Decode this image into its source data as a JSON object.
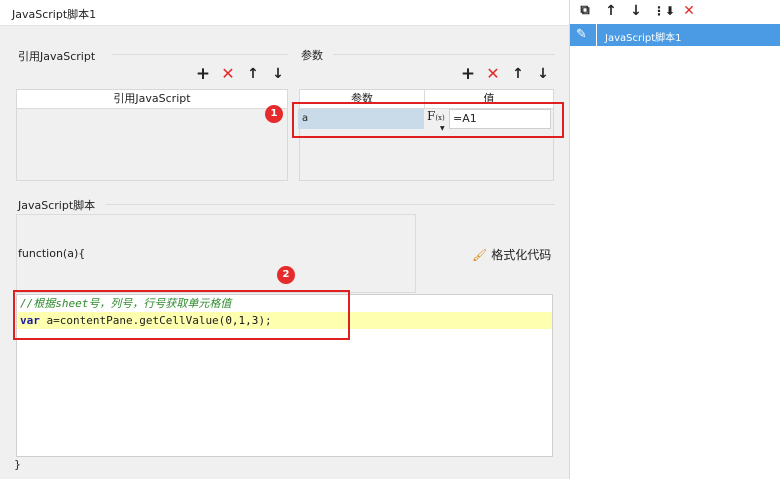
{
  "window": {
    "title": "JavaScript脚本1"
  },
  "libs": {
    "section_label": "引用JavaScript",
    "column_header": "引用JavaScript"
  },
  "params": {
    "section_label": "参数",
    "col_param": "参数",
    "col_value": "值",
    "row": {
      "name": "a",
      "formula_icon_text": "F",
      "formula_icon_sub": "(x)",
      "value": "=A1"
    }
  },
  "script": {
    "section_label": "JavaScript脚本",
    "function_signature": "function(a){",
    "format_label": "格式化代码",
    "code": {
      "comment": "//根据sheet号，列号，行号获取单元格值",
      "keyword": "var",
      "statement_start": " a=contentPane.getCellValue(",
      "args": "0,1,3",
      "statement_end": ");"
    },
    "closing": "}"
  },
  "annotations": {
    "badge1": "1",
    "badge2": "2"
  },
  "sidebar": {
    "items": [
      {
        "label": "JavaScript脚本1",
        "selected": true
      }
    ]
  },
  "icons": {
    "add": "plus-icon",
    "remove": "x-icon",
    "up": "arrow-up-icon",
    "down": "arrow-down-icon",
    "copy": "copy-icon",
    "move_bottom": "move-to-bottom-icon",
    "edit": "pencil-icon",
    "format": "brush-icon"
  },
  "colors": {
    "accent": "#4a9be4",
    "delete": "#e02b2b",
    "highlight_line": "#ffffb0",
    "param_cell": "#c9dbe8",
    "annotation_red": "#e02020"
  }
}
